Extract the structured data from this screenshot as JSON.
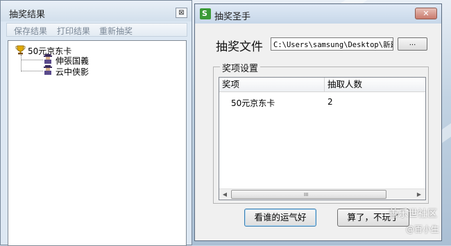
{
  "left_window": {
    "title": "抽奖结果",
    "close_glyph": "⊠",
    "menu": [
      "保存结果",
      "打印结果",
      "重新抽奖"
    ],
    "tree": {
      "root": "50元京东卡",
      "children": [
        "伸張国義",
        "云中侠影"
      ]
    }
  },
  "right_window": {
    "title": "抽奖圣手",
    "app_icon_glyph": "S",
    "close_glyph": "✕",
    "file_label": "抽奖文件",
    "file_path": "C:\\Users\\samsung\\Desktop\\新建",
    "browse_label": "...",
    "group_label": "奖项设置",
    "columns": [
      "奖项",
      "抽取人数"
    ],
    "rows": [
      {
        "prize": "50元京东卡",
        "count": "2"
      }
    ],
    "scroll_left": "◀",
    "scroll_right": "▶",
    "scroll_grip": "III",
    "btn_lucky": "看谁的运气好",
    "btn_forget": "算了，不玩了"
  },
  "watermark": {
    "line1": "善乐世社区",
    "line2": "@百小生"
  }
}
